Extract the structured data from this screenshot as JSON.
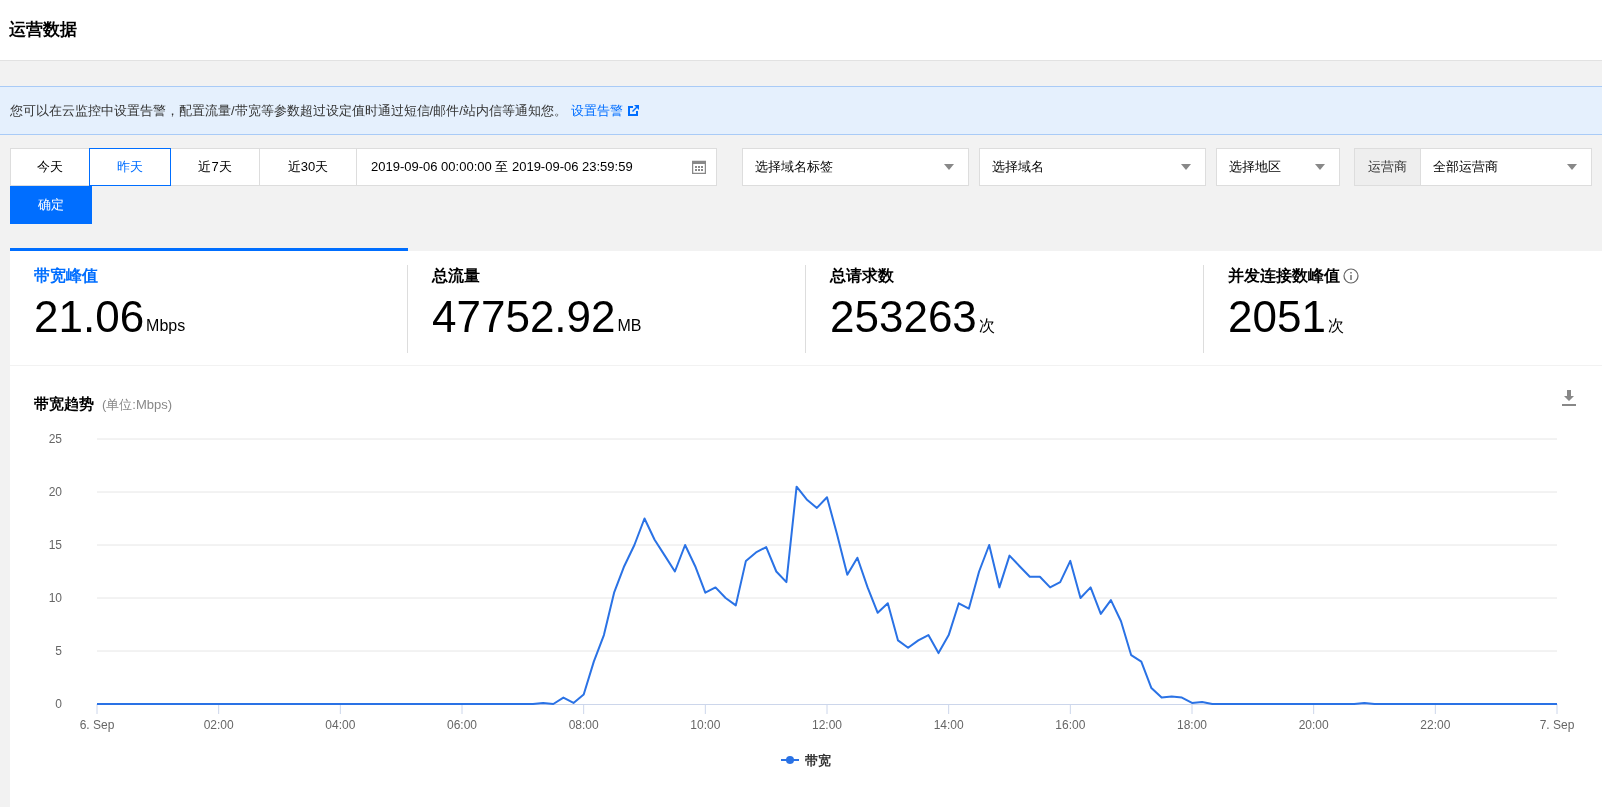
{
  "page": {
    "title": "运营数据"
  },
  "notice": {
    "text": "您可以在云监控中设置告警，配置流量/带宽等参数超过设定值时通过短信/邮件/站内信等通知您。",
    "link": "设置告警"
  },
  "quick_ranges": [
    {
      "label": "今天",
      "selected": false
    },
    {
      "label": "昨天",
      "selected": true
    },
    {
      "label": "近7天",
      "selected": false
    },
    {
      "label": "近30天",
      "selected": false
    }
  ],
  "date_range": {
    "value": "2019-09-06 00:00:00 至 2019-09-06 23:59:59"
  },
  "selects": [
    {
      "value": "选择域名标签"
    },
    {
      "value": "选择域名"
    },
    {
      "value": "选择地区"
    }
  ],
  "operator": {
    "label": "运营商",
    "value": "全部运营商"
  },
  "confirm_button": "确定",
  "stats": [
    {
      "title": "带宽峰值",
      "value": "21.06",
      "unit": "Mbps",
      "selected": true,
      "info": false
    },
    {
      "title": "总流量",
      "value": "47752.92",
      "unit": "MB",
      "selected": false,
      "info": false
    },
    {
      "title": "总请求数",
      "value": "253263",
      "unit": "次",
      "selected": false,
      "info": false
    },
    {
      "title": "并发连接数峰值",
      "value": "2051",
      "unit": "次",
      "selected": false,
      "info": true
    }
  ],
  "chart": {
    "title": "带宽趋势",
    "unit": "(单位:Mbps)",
    "chart_data": {
      "type": "line",
      "grid": true,
      "xlim": [
        0,
        1440
      ],
      "ylim": [
        0,
        25
      ],
      "yticks": [
        0,
        5,
        10,
        15,
        20,
        25
      ],
      "xticks": [
        {
          "value": 0,
          "label": "6. Sep"
        },
        {
          "value": 120,
          "label": "02:00"
        },
        {
          "value": 240,
          "label": "04:00"
        },
        {
          "value": 360,
          "label": "06:00"
        },
        {
          "value": 480,
          "label": "08:00"
        },
        {
          "value": 600,
          "label": "10:00"
        },
        {
          "value": 720,
          "label": "12:00"
        },
        {
          "value": 840,
          "label": "14:00"
        },
        {
          "value": 960,
          "label": "16:00"
        },
        {
          "value": 1080,
          "label": "18:00"
        },
        {
          "value": 1200,
          "label": "20:00"
        },
        {
          "value": 1320,
          "label": "22:00"
        },
        {
          "value": 1440,
          "label": "7. Sep"
        }
      ],
      "x": [
        0,
        10,
        20,
        30,
        40,
        50,
        60,
        70,
        80,
        90,
        100,
        110,
        120,
        130,
        140,
        150,
        160,
        170,
        180,
        190,
        200,
        210,
        220,
        230,
        240,
        250,
        260,
        270,
        280,
        290,
        300,
        310,
        320,
        330,
        340,
        350,
        360,
        370,
        380,
        390,
        400,
        410,
        420,
        430,
        440,
        450,
        460,
        470,
        480,
        490,
        500,
        510,
        520,
        530,
        540,
        550,
        560,
        570,
        580,
        590,
        600,
        610,
        620,
        630,
        640,
        650,
        660,
        670,
        680,
        690,
        700,
        710,
        720,
        730,
        740,
        750,
        760,
        770,
        780,
        790,
        800,
        810,
        820,
        830,
        840,
        850,
        860,
        870,
        880,
        890,
        900,
        910,
        920,
        930,
        940,
        950,
        960,
        970,
        980,
        990,
        1000,
        1010,
        1020,
        1030,
        1040,
        1050,
        1060,
        1070,
        1080,
        1090,
        1100,
        1110,
        1120,
        1130,
        1140,
        1150,
        1160,
        1170,
        1180,
        1190,
        1200,
        1210,
        1220,
        1230,
        1240,
        1250,
        1260,
        1270,
        1280,
        1290,
        1300,
        1310,
        1320,
        1330,
        1340,
        1350,
        1360,
        1370,
        1380,
        1390,
        1400,
        1410,
        1420,
        1430,
        1440
      ],
      "series": [
        {
          "name": "带宽",
          "color": "#2a72e5",
          "values": [
            0,
            0,
            0,
            0,
            0,
            0,
            0,
            0,
            0,
            0,
            0,
            0,
            0,
            0,
            0,
            0,
            0,
            0,
            0,
            0,
            0,
            0,
            0,
            0,
            0,
            0,
            0,
            0,
            0,
            0,
            0,
            0,
            0,
            0,
            0,
            0,
            0,
            0,
            0,
            0,
            0,
            0,
            0,
            0,
            0.1,
            0,
            0.6,
            0.1,
            0.9,
            4.0,
            6.5,
            10.5,
            13,
            15,
            17.5,
            15.5,
            14,
            12.5,
            15,
            13,
            10.5,
            11,
            10,
            9.3,
            13.5,
            14.3,
            14.8,
            12.5,
            11.5,
            20.5,
            19.3,
            18.5,
            19.5,
            16,
            12.2,
            13.8,
            11,
            8.6,
            9.5,
            6,
            5.3,
            6,
            6.5,
            4.8,
            6.5,
            9.5,
            9,
            12.5,
            15,
            11,
            14,
            13,
            12,
            12,
            11,
            11.5,
            13.5,
            10,
            11,
            8.5,
            9.8,
            7.8,
            4.6,
            4,
            1.5,
            0.6,
            0.7,
            0.6,
            0.1,
            0.2,
            0,
            0,
            0,
            0,
            0,
            0,
            0,
            0,
            0,
            0,
            0,
            0,
            0,
            0,
            0,
            0.1,
            0,
            0,
            0,
            0,
            0,
            0,
            0,
            0,
            0,
            0,
            0,
            0,
            0,
            0,
            0,
            0,
            0,
            0,
            0
          ]
        }
      ]
    }
  }
}
